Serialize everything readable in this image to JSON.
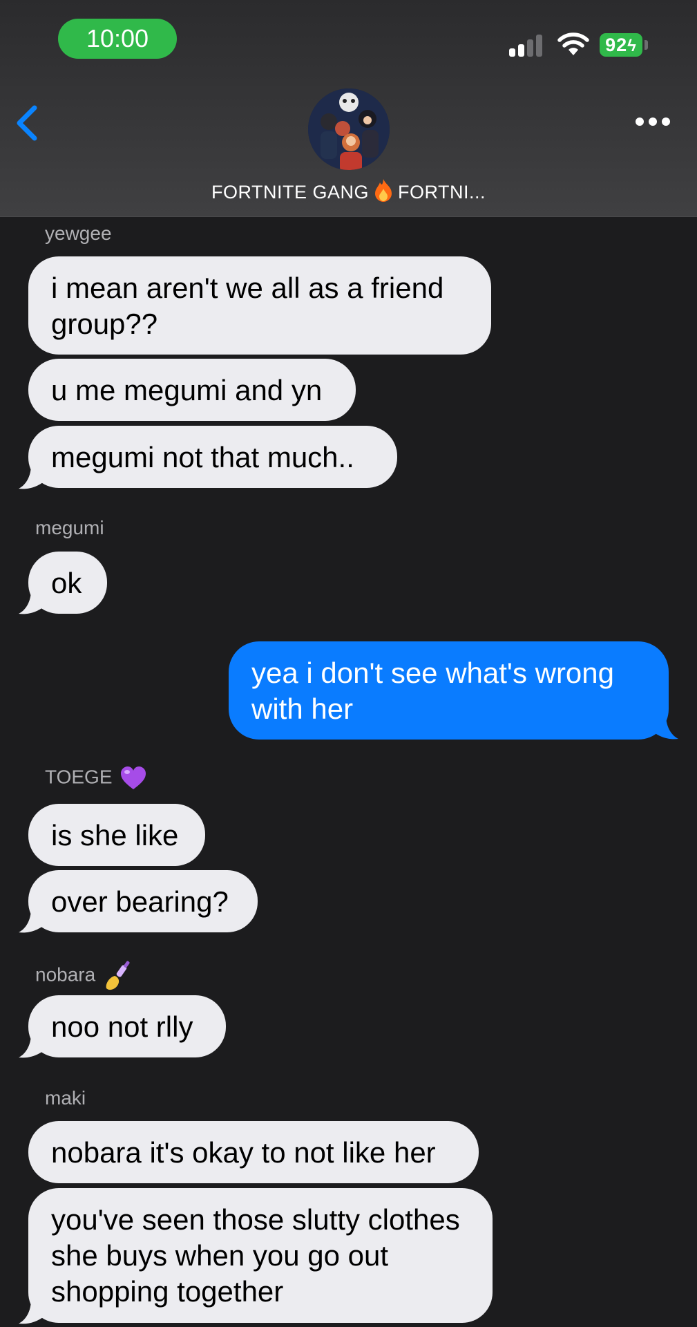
{
  "status_bar": {
    "time": "10:00",
    "battery": "92"
  },
  "header": {
    "title_part1": "FORTNITE GANG",
    "title_part2": "FORTNI...",
    "title_emoji": "fire-emoji"
  },
  "colors": {
    "background": "#1c1c1e",
    "incoming_bubble": "#ececf0",
    "outgoing_bubble": "#0a7cff",
    "status_green": "#30b94a",
    "back_blue": "#0a84ff"
  },
  "messages": {
    "sender1": "yewgee",
    "m1": "i mean aren't we all as a friend group??",
    "m2": "u me megumi and yn",
    "m3": "megumi not that much..",
    "sender2": "megumi",
    "m4": "ok",
    "m5": "yea i don't see what's wrong with her",
    "sender3": "TOEGE",
    "sender3_emoji": "purple-heart-emoji",
    "m6": "is she like",
    "m7": "over bearing?",
    "sender4": "nobara",
    "sender4_emoji": "nail-polish-emoji",
    "m8": "noo not rlly",
    "sender5": "maki",
    "m9": "nobara it's okay to not like her",
    "m10": "you've seen those slutty clothes she buys when you go out shopping together"
  }
}
